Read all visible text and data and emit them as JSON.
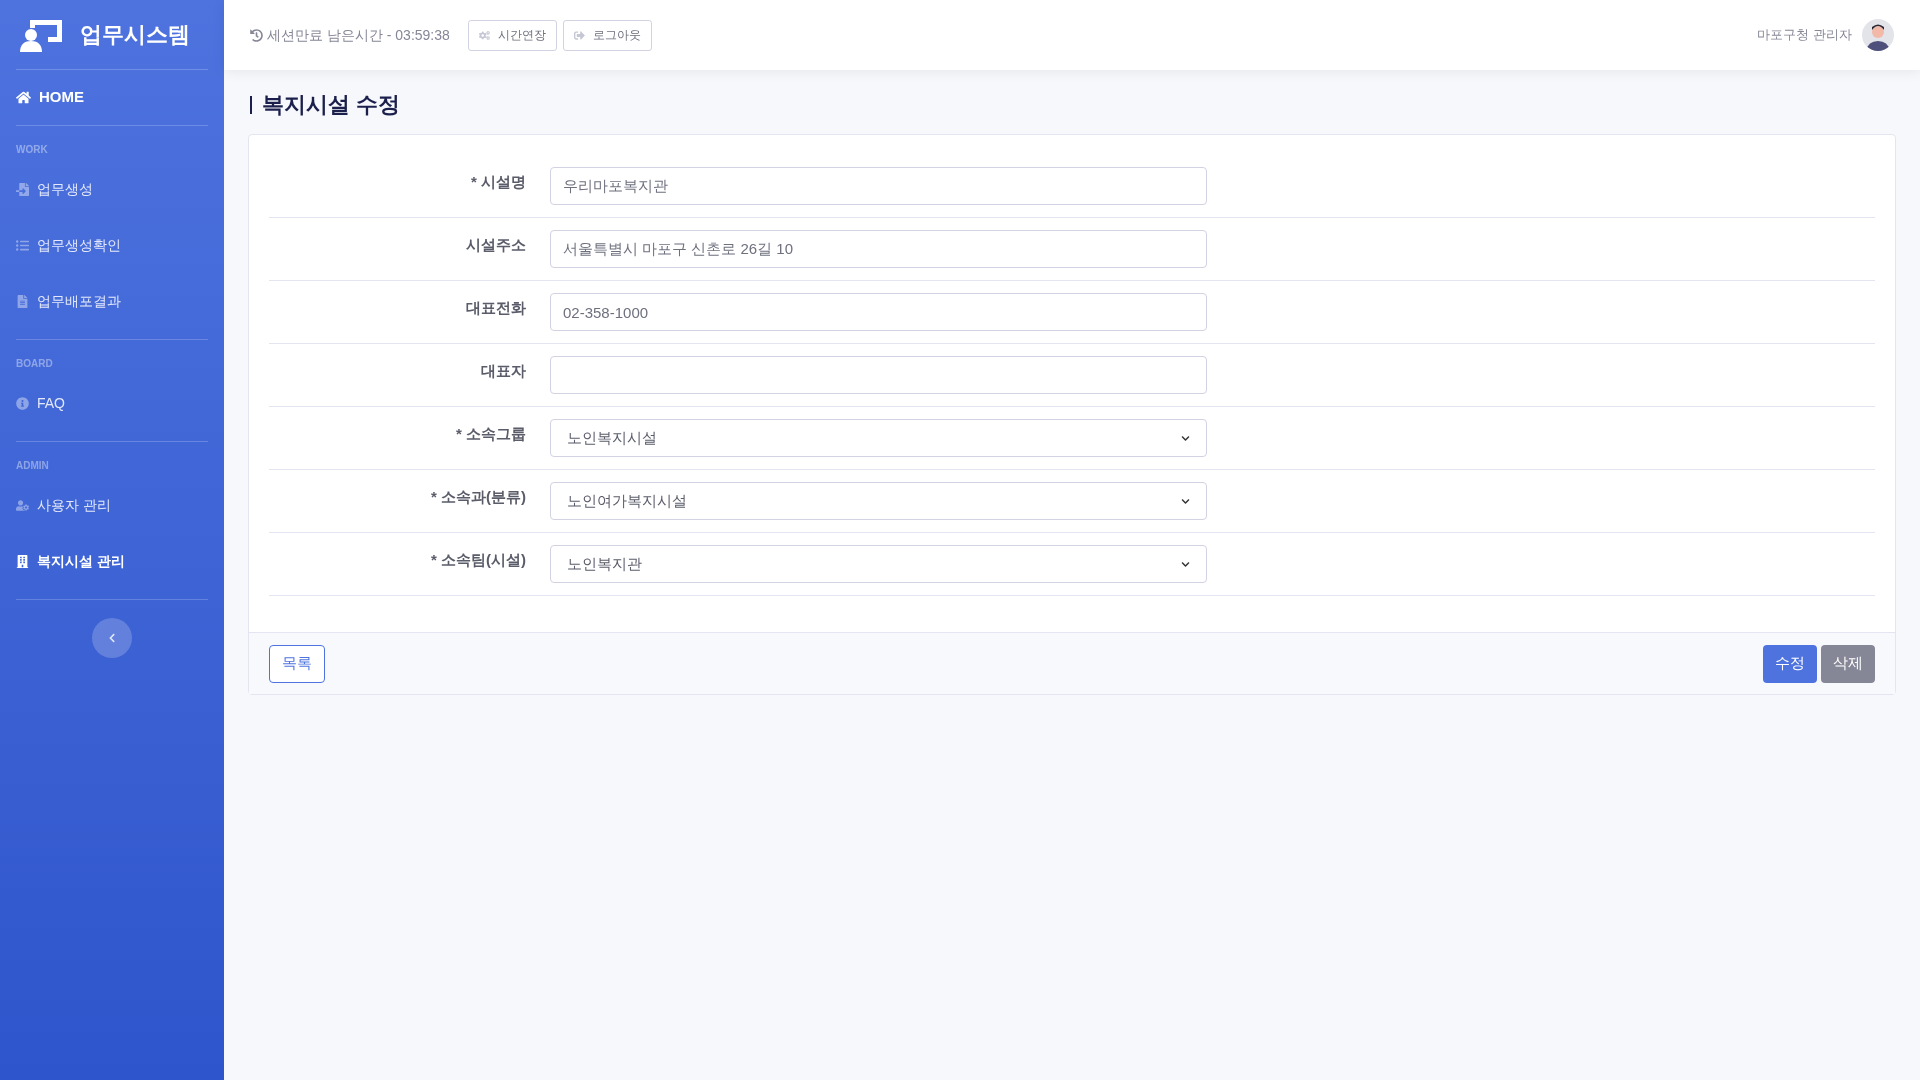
{
  "brand": {
    "title": "업무시스템"
  },
  "sidebar": {
    "home": {
      "label": "HOME",
      "selected": true
    },
    "sections": [
      {
        "heading": "WORK",
        "items": [
          {
            "label": "업무생성",
            "kind": "file",
            "selected": false
          },
          {
            "label": "업무생성확인",
            "kind": "list",
            "selected": false
          },
          {
            "label": "업무배포결과",
            "kind": "doc",
            "selected": false
          }
        ]
      },
      {
        "heading": "BOARD",
        "items": [
          {
            "label": "FAQ",
            "kind": "info",
            "selected": false
          }
        ]
      },
      {
        "heading": "ADMIN",
        "items": [
          {
            "label": "사용자 관리",
            "kind": "user",
            "selected": false
          },
          {
            "label": "복지시설 관리",
            "kind": "building",
            "selected": true
          }
        ]
      }
    ]
  },
  "topbar": {
    "session": "세션만료 남은시간 - 03:59:38",
    "buttons": [
      {
        "label": "시간연장",
        "kind": "gears"
      },
      {
        "label": "로그아웃",
        "kind": "logout"
      }
    ],
    "user": "마포구청 관리자"
  },
  "page": {
    "title": "복지시설 수정"
  },
  "form": {
    "fields": [
      {
        "label": "* 시설명",
        "kind": "text",
        "value": "우리마포복지관"
      },
      {
        "label": "시설주소",
        "kind": "text",
        "value": "서울특별시 마포구 신촌로 26길 10"
      },
      {
        "label": "대표전화",
        "kind": "text",
        "value": "02-358-1000"
      },
      {
        "label": "대표자",
        "kind": "text"
      },
      {
        "label": "* 소속그룹",
        "kind": "select",
        "value": "노인복지시설"
      },
      {
        "label": "* 소속과(분류)",
        "kind": "select",
        "value": "노인여가복지시설"
      },
      {
        "label": "* 소속팀(시설)",
        "kind": "select",
        "value": "노인복지관"
      }
    ]
  },
  "footer": {
    "list_button": "목록",
    "buttons": [
      {
        "label": "수정",
        "kind": "primary"
      },
      {
        "label": "삭제",
        "kind": "secondary"
      }
    ]
  }
}
